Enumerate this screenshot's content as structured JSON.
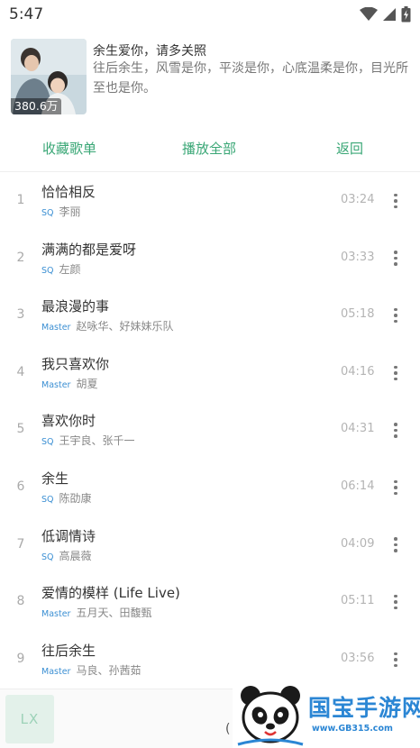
{
  "status_bar": {
    "time": "5:47"
  },
  "playlist": {
    "title": "余生爱你，请多关照",
    "description": "往后余生，风雪是你，平淡是你，心底温柔是你，目光所至也是你。",
    "play_count": "380.6万"
  },
  "actions": {
    "collect": "收藏歌单",
    "play_all": "播放全部",
    "back": "返回"
  },
  "songs": [
    {
      "index": "1",
      "title": "恰恰相反",
      "quality": "SQ",
      "artist": "李丽",
      "duration": "03:24"
    },
    {
      "index": "2",
      "title": "满满的都是爱呀",
      "quality": "SQ",
      "artist": "左颜",
      "duration": "03:33"
    },
    {
      "index": "3",
      "title": "最浪漫的事",
      "quality": "Master",
      "artist": "赵咏华、好妹妹乐队",
      "duration": "05:18"
    },
    {
      "index": "4",
      "title": "我只喜欢你",
      "quality": "Master",
      "artist": "胡夏",
      "duration": "04:16"
    },
    {
      "index": "5",
      "title": "喜欢你时",
      "quality": "SQ",
      "artist": "王宇良、张千一",
      "duration": "04:31"
    },
    {
      "index": "6",
      "title": "余生",
      "quality": "SQ",
      "artist": "陈劭康",
      "duration": "06:14"
    },
    {
      "index": "7",
      "title": "低调情诗",
      "quality": "SQ",
      "artist": "高晨薇",
      "duration": "04:09"
    },
    {
      "index": "8",
      "title": "爱情的模样 (Life Live)",
      "quality": "Master",
      "artist": "五月天、田馥甄",
      "duration": "05:11"
    },
    {
      "index": "9",
      "title": "往后余生",
      "quality": "Master",
      "artist": "马良、孙茜茹",
      "duration": "03:56"
    }
  ],
  "player": {
    "thumb_label": "LX",
    "control_glyph": "("
  },
  "watermark": {
    "text": "国宝手游网",
    "url": "www.GB315.com"
  },
  "colors": {
    "accent": "#3aa776",
    "quality": "#3b8fd3",
    "watermark": "#2b86d4"
  }
}
